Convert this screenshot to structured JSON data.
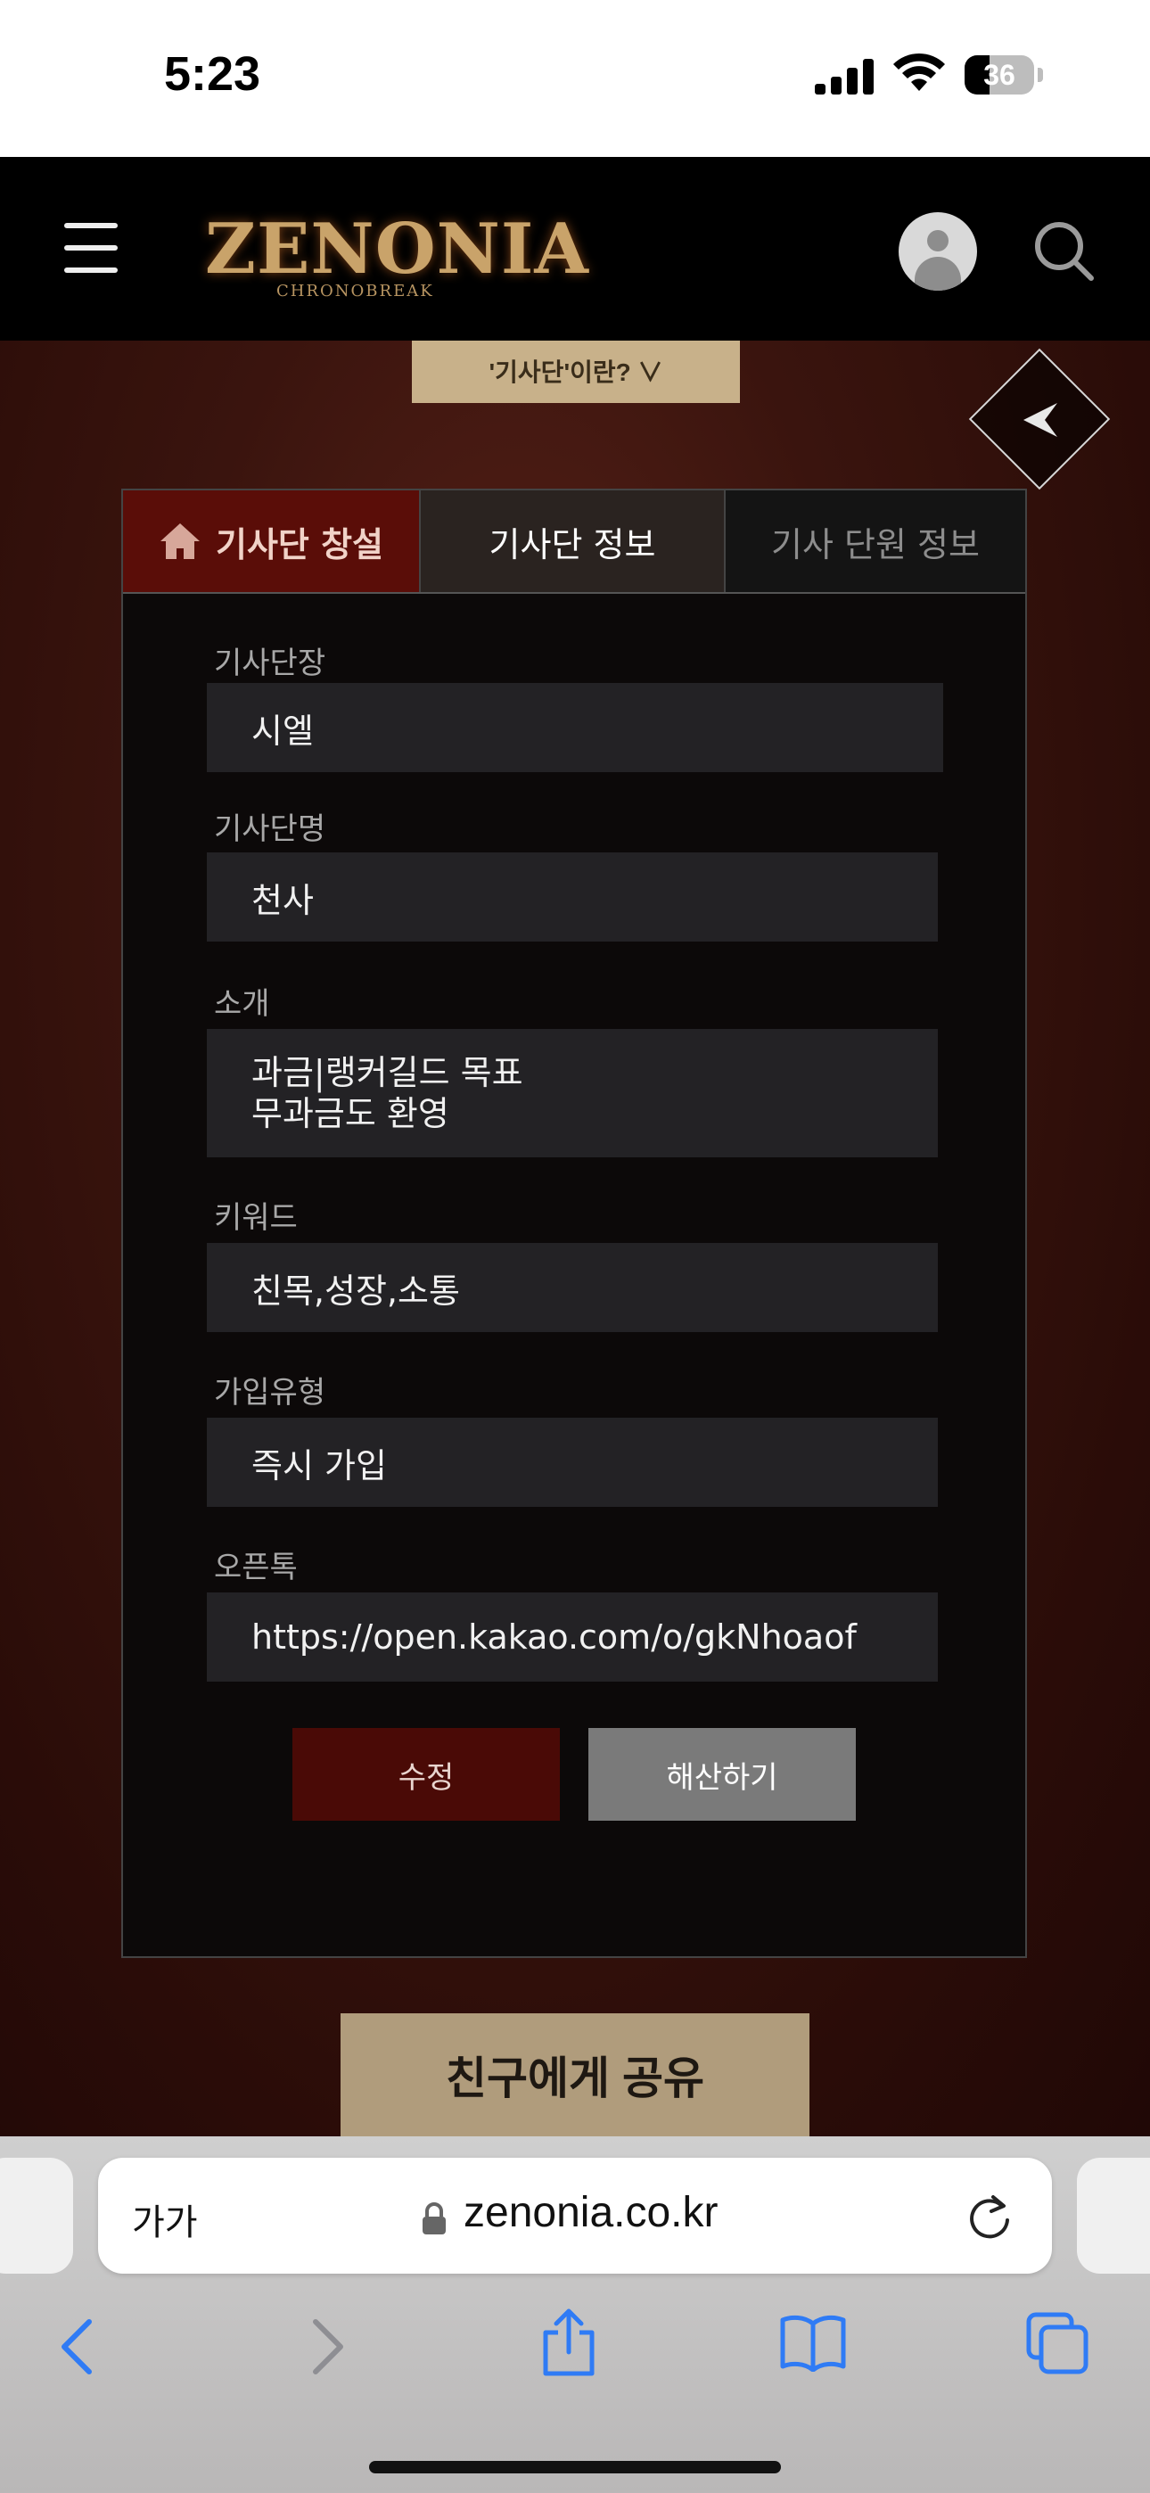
{
  "status_bar": {
    "time": "5:23",
    "battery": "36"
  },
  "header": {
    "logo_main": "ZENONIA",
    "logo_sub": "CHRONOBREAK"
  },
  "page": {
    "what_is_guild_label": "'기사단'이란? ∨",
    "tabs": [
      {
        "label": "기사단 창설"
      },
      {
        "label": "기사단 정보"
      },
      {
        "label": "기사 단원 정보"
      }
    ],
    "fields": {
      "leader": {
        "label": "기사단장",
        "value": "시엘"
      },
      "name": {
        "label": "기사단명",
        "value": "천사"
      },
      "intro": {
        "label": "소개",
        "line1": "과금|랭커길드 목표",
        "line2": "무과금도 환영"
      },
      "keywords": {
        "label": "키워드",
        "value": "친목,성장,소통"
      },
      "join_type": {
        "label": "가입유형",
        "value": "즉시 가입"
      },
      "open_chat": {
        "label": "오픈톡",
        "value": "https://open.kakao.com/o/gkNhoaof"
      }
    },
    "edit_label": "수정",
    "dissolve_label": "해산하기",
    "share_label": "친구에게 공유"
  },
  "browser": {
    "text_size_label": "가가",
    "url": "zenonia.co.kr"
  }
}
